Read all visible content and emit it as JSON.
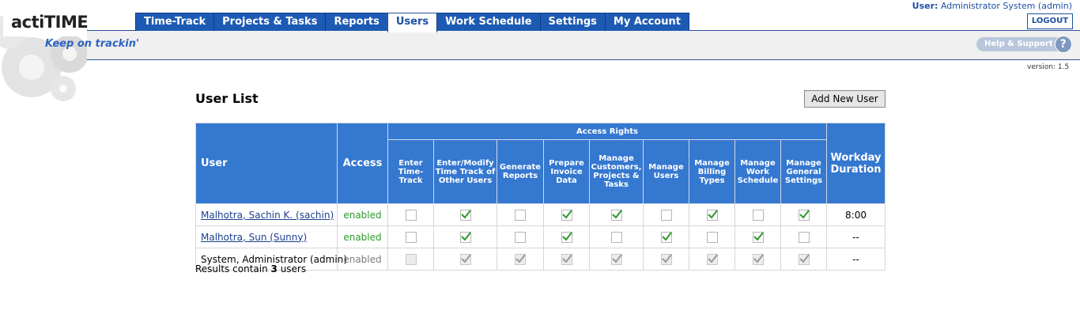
{
  "app": {
    "logo_text": "actiTIME",
    "tagline": "Keep on trackin'",
    "version": "version: 1.5"
  },
  "nav": {
    "tabs": [
      {
        "label": "Time-Track",
        "active": false
      },
      {
        "label": "Projects & Tasks",
        "active": false
      },
      {
        "label": "Reports",
        "active": false
      },
      {
        "label": "Users",
        "active": true
      },
      {
        "label": "Work Schedule",
        "active": false
      },
      {
        "label": "Settings",
        "active": false
      },
      {
        "label": "My Account",
        "active": false
      }
    ]
  },
  "user_info": {
    "label": "User:",
    "name": "Administrator System (admin)",
    "logout": "LOGOUT"
  },
  "help": {
    "label": "Help & Support",
    "icon": "?"
  },
  "page": {
    "title": "User List",
    "add_button": "Add New User"
  },
  "table": {
    "headers": {
      "user": "User",
      "access": "Access",
      "rights_group": "Access Rights",
      "workday": "Workday Duration"
    },
    "rights": [
      "Enter Time-Track",
      "Enter/Modify Time Track of Other Users",
      "Generate Reports",
      "Prepare Invoice Data",
      "Manage Customers, Projects & Tasks",
      "Manage Users",
      "Manage Billing Types",
      "Manage Work Schedule",
      "Manage General Settings"
    ],
    "rows": [
      {
        "user": "Malhotra, Sachin K. (sachin)",
        "link": true,
        "access": "enabled",
        "disabled": false,
        "rights": [
          false,
          true,
          false,
          true,
          true,
          false,
          true,
          false,
          true
        ],
        "workday": "8:00"
      },
      {
        "user": "Malhotra, Sun (Sunny)",
        "link": true,
        "access": "enabled",
        "disabled": false,
        "rights": [
          false,
          true,
          false,
          true,
          false,
          true,
          false,
          true,
          false
        ],
        "workday": "--"
      },
      {
        "user": "System, Administrator (admin)",
        "link": false,
        "access": "enabled",
        "disabled": true,
        "rights": [
          false,
          true,
          true,
          true,
          true,
          true,
          true,
          true,
          true
        ],
        "workday": "--"
      }
    ]
  },
  "results": {
    "prefix": "Results contain ",
    "count": "3",
    "suffix": " users"
  },
  "colors": {
    "tab_blue": "#1d5ab4",
    "header_blue": "#3578d0",
    "check_green": "#2a9a2a",
    "link_blue": "#1d3f8f"
  }
}
